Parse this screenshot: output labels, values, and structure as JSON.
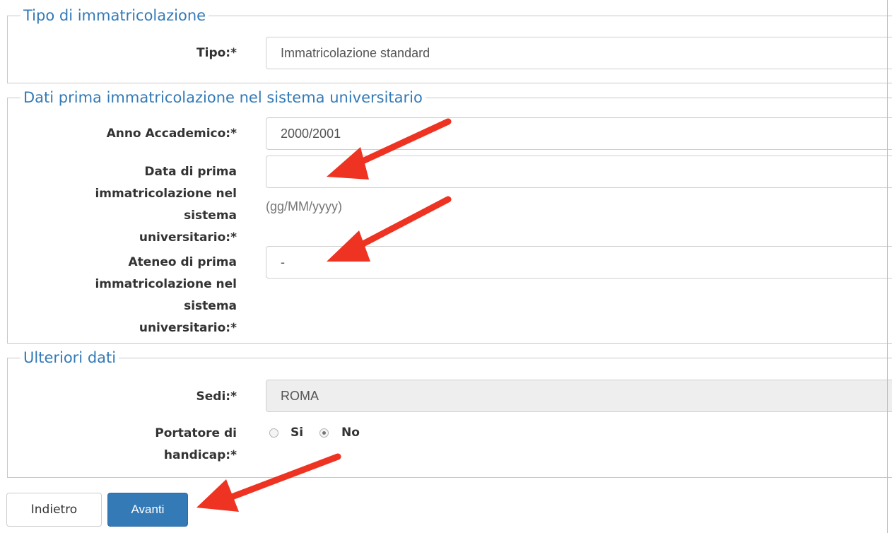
{
  "section1": {
    "legend": "Tipo di immatricolazione",
    "tipo_label": "Tipo:*",
    "tipo_value": "Immatricolazione standard"
  },
  "section2": {
    "legend": "Dati prima immatricolazione nel sistema universitario",
    "anno_label": "Anno Accademico:*",
    "anno_value": "2000/2001",
    "data_label": "Data di prima immatricolazione nel sistema universitario:*",
    "data_value": "",
    "data_hint": "(gg/MM/yyyy)",
    "ateneo_label": "Ateneo di prima immatricolazione nel sistema universitario:*",
    "ateneo_value": "-"
  },
  "section3": {
    "legend": "Ulteriori dati",
    "sedi_label": "Sedi:*",
    "sedi_value": "ROMA",
    "handicap_label": "Portatore di handicap:*",
    "option_si": "Si",
    "option_no": "No",
    "selected": "No"
  },
  "buttons": {
    "back": "Indietro",
    "next": "Avanti"
  },
  "colors": {
    "legend": "#337ab7",
    "primary_button": "#337ab7",
    "annotation_arrow": "#ee3322"
  }
}
